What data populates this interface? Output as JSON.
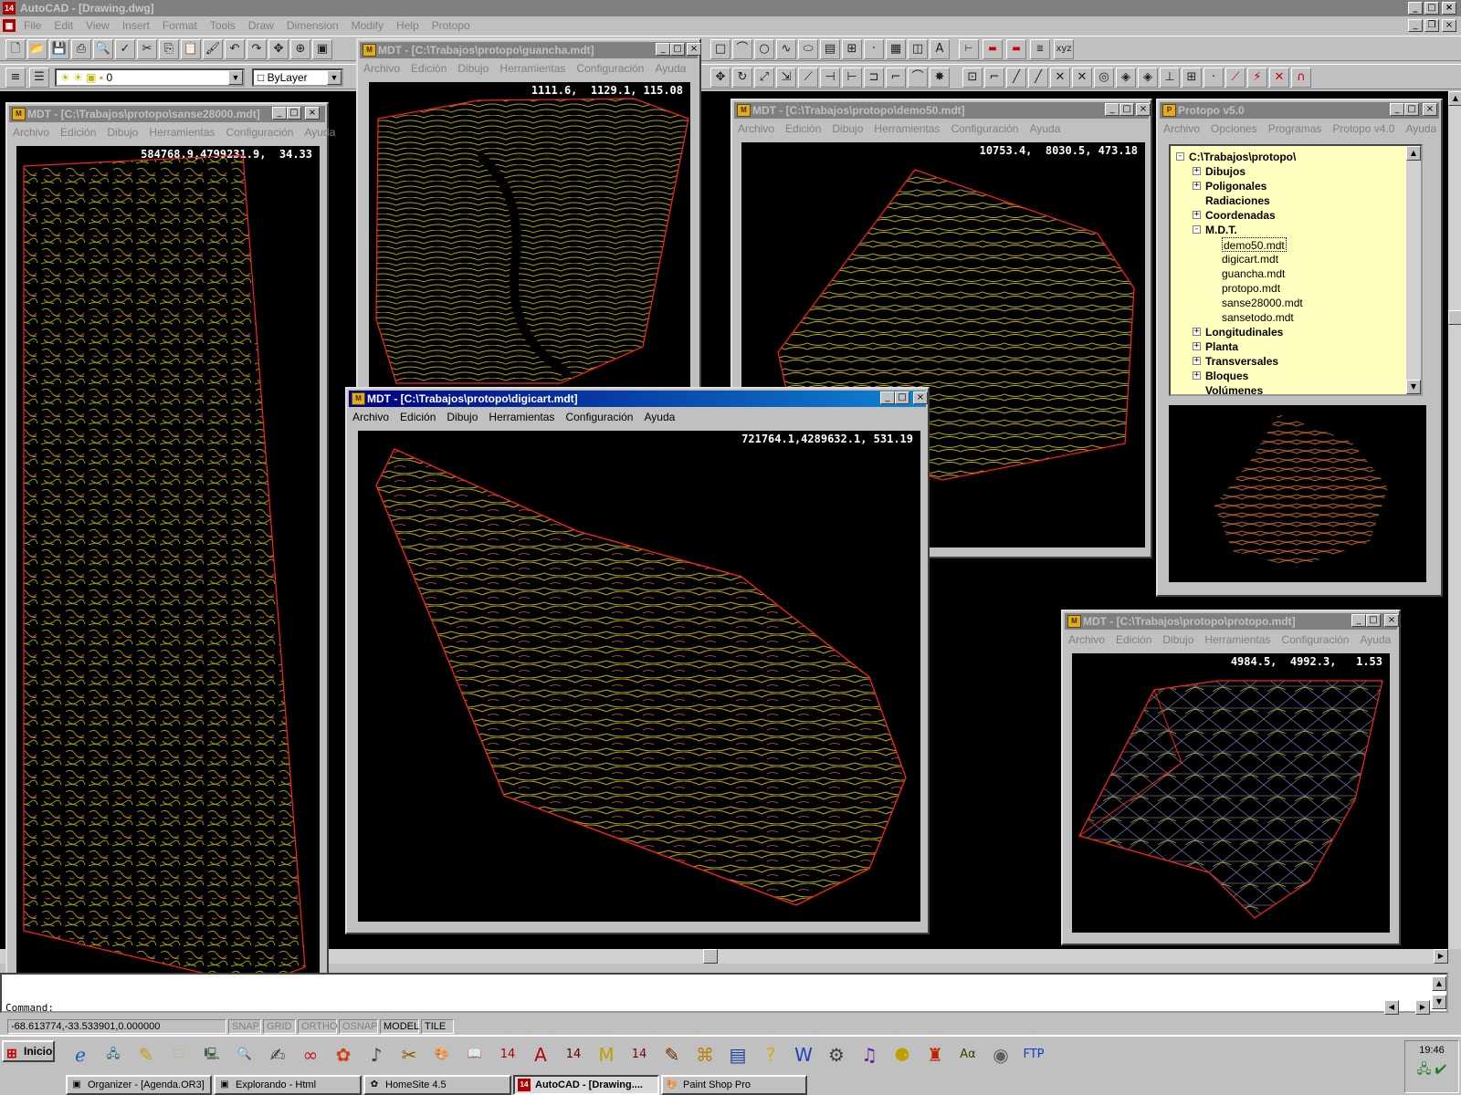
{
  "app": {
    "title": "AutoCAD - [Drawing.dwg]",
    "icon_label": "14",
    "menus": [
      "File",
      "Edit",
      "View",
      "Insert",
      "Format",
      "Tools",
      "Draw",
      "Dimension",
      "Modify",
      "Help",
      "Protopo"
    ]
  },
  "layer_bar": {
    "layer_value": "0",
    "color_value": "ByLayer"
  },
  "mdt_menus": [
    "Archivo",
    "Edición",
    "Dibujo",
    "Herramientas",
    "Configuración",
    "Ayuda"
  ],
  "windows": {
    "sanse": {
      "title": "MDT - [C:\\Trabajos\\protopo\\sanse28000.mdt]",
      "coord": "584768.9,4799231.9,  34.33"
    },
    "guancha": {
      "title": "MDT - [C:\\Trabajos\\protopo\\guancha.mdt]",
      "coord": "1111.6,  1129.1, 115.08"
    },
    "demo50": {
      "title": "MDT - [C:\\Trabajos\\protopo\\demo50.mdt]",
      "coord": "10753.4,  8030.5, 473.18"
    },
    "digicart": {
      "title": "MDT - [C:\\Trabajos\\protopo\\digicart.mdt]",
      "coord": "721764.1,4289632.1, 531.19"
    },
    "protopo_mdt": {
      "title": "MDT - [C:\\Trabajos\\protopo\\protopo.mdt]",
      "coord": "4984.5,  4992.3,   1.53"
    }
  },
  "protopo_panel": {
    "title": "Protopo v5.0",
    "menus": [
      "Archivo",
      "Opciones",
      "Programas",
      "Protopo v4.0",
      "Ayuda"
    ],
    "tree": [
      {
        "label": "C:\\Trabajos\\protopo\\",
        "level": 0,
        "expander": "-",
        "bold": true
      },
      {
        "label": "Dibujos",
        "level": 1,
        "expander": "+",
        "bold": true
      },
      {
        "label": "Poligonales",
        "level": 1,
        "expander": "+",
        "bold": true
      },
      {
        "label": "Radiaciones",
        "level": 1,
        "expander": "",
        "bold": true
      },
      {
        "label": "Coordenadas",
        "level": 1,
        "expander": "+",
        "bold": true
      },
      {
        "label": "M.D.T.",
        "level": 1,
        "expander": "-",
        "bold": true
      },
      {
        "label": "demo50.mdt",
        "level": 2,
        "expander": "",
        "bold": false,
        "selected": true
      },
      {
        "label": "digicart.mdt",
        "level": 2,
        "expander": "",
        "bold": false
      },
      {
        "label": "guancha.mdt",
        "level": 2,
        "expander": "",
        "bold": false
      },
      {
        "label": "protopo.mdt",
        "level": 2,
        "expander": "",
        "bold": false
      },
      {
        "label": "sanse28000.mdt",
        "level": 2,
        "expander": "",
        "bold": false
      },
      {
        "label": "sansetodo.mdt",
        "level": 2,
        "expander": "",
        "bold": false
      },
      {
        "label": "Longitudinales",
        "level": 1,
        "expander": "+",
        "bold": true
      },
      {
        "label": "Planta",
        "level": 1,
        "expander": "+",
        "bold": true
      },
      {
        "label": "Transversales",
        "level": 1,
        "expander": "+",
        "bold": true
      },
      {
        "label": "Bloques",
        "level": 1,
        "expander": "+",
        "bold": true
      },
      {
        "label": "Volúmenes",
        "level": 1,
        "expander": "",
        "bold": true
      }
    ]
  },
  "command": {
    "prompt": "Command:"
  },
  "status": {
    "coords": "-68.613774,-33.533901,0.000000",
    "toggles": [
      "SNAP",
      "GRID",
      "ORTHO",
      "OSNAP",
      "MODEL",
      "TILE"
    ]
  },
  "taskbar": {
    "start_label": "Inicio",
    "buttons": [
      "Organizer - [Agenda.OR3]",
      "Explorando - Html",
      "HomeSite 4.5",
      "AutoCAD - [Drawing....",
      "Paint Shop Pro"
    ],
    "clock": "19:46"
  },
  "colors": {
    "contour_yellow": "#c8b400",
    "contour_olive": "#8a8a00",
    "contour_orange": "#c06020",
    "boundary_red": "#ff2020",
    "active_title": "#000080"
  }
}
